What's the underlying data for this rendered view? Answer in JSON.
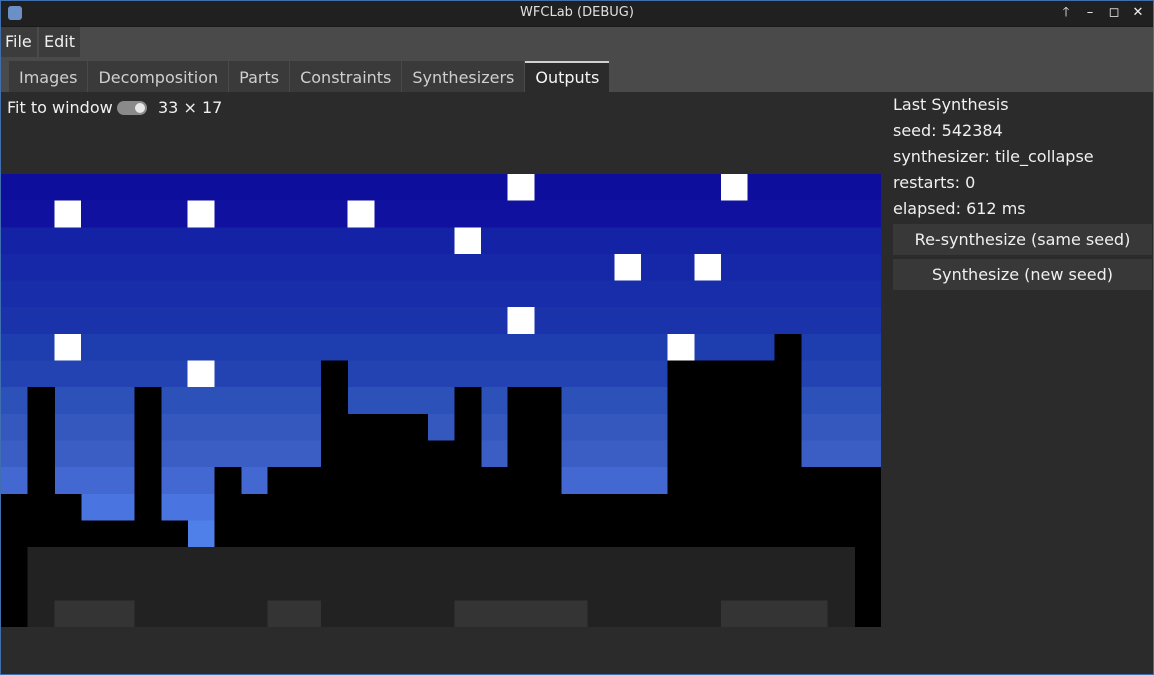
{
  "window": {
    "title": "WFCLab (DEBUG)",
    "controls": [
      "🡑",
      "–",
      "◻",
      "✕"
    ]
  },
  "menu": {
    "items": [
      "File",
      "Edit"
    ]
  },
  "tabs": {
    "items": [
      "Images",
      "Decomposition",
      "Parts",
      "Constraints",
      "Synthesizers",
      "Outputs"
    ],
    "active_index": 5
  },
  "output": {
    "fit_label": "Fit to window",
    "fit_on": true,
    "dims": "33 × 17",
    "grid": {
      "cols": 33,
      "rows": 17,
      "sky_row_colors": [
        "#0e0e9c",
        "#10119f",
        "#1422a5",
        "#1627a7",
        "#182da9",
        "#1a33ab",
        "#1e3dae",
        "#2243b1",
        "#2c52b9",
        "#3458be",
        "#3a5ec4",
        "#4368d2",
        "#4a75e0",
        "#4f80ea",
        "#4f80ea",
        "#4f80ea",
        "#4f80ea"
      ],
      "silhouette_color": "#000000",
      "ground_colors": [
        "#222222",
        "#343434"
      ],
      "star_color": "#ffffff",
      "skyline_heights": [
        5,
        9,
        5,
        4,
        4,
        9,
        4,
        3,
        6,
        5,
        6,
        6,
        10,
        8,
        8,
        8,
        7,
        9,
        6,
        9,
        9,
        5,
        5,
        5,
        5,
        10,
        10,
        10,
        10,
        11,
        6,
        6,
        6
      ],
      "stars": [
        [
          0,
          19
        ],
        [
          0,
          27
        ],
        [
          1,
          2
        ],
        [
          1,
          7
        ],
        [
          1,
          13
        ],
        [
          2,
          17
        ],
        [
          3,
          23
        ],
        [
          3,
          26
        ],
        [
          5,
          19
        ],
        [
          6,
          2
        ],
        [
          6,
          25
        ],
        [
          7,
          7
        ]
      ]
    }
  },
  "last_synthesis": {
    "heading": "Last Synthesis",
    "seed": "seed: 542384",
    "synthesizer": "synthesizer: tile_collapse",
    "restarts": "restarts: 0",
    "elapsed": "elapsed: 612 ms"
  },
  "actions": {
    "resynth_label": "Re-synthesize (same seed)",
    "synth_new_label": "Synthesize (new seed)"
  },
  "colors": {
    "accent": "#3f6fae",
    "panel_bg": "#2b2b2b",
    "tab_bar_bg": "#4a4a4a"
  }
}
